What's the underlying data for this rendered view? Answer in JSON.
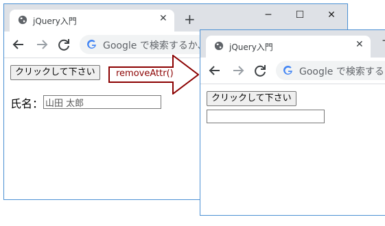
{
  "before": {
    "tab_title": "jQuery入門",
    "omnibox_text": "Google で検索するか、UI",
    "button_label": "クリックして下さい",
    "field_label": "氏名：",
    "field_value": "山田 太郎"
  },
  "after": {
    "tab_title": "jQuery入門",
    "omnibox_text": "Google で検索するか、",
    "button_label": "クリックして下さい",
    "field_value": ""
  },
  "arrow_label": "removeAttr()",
  "icons": {
    "tab_favicon": "globe-icon",
    "tab_close": "close-icon",
    "new_tab": "plus-icon",
    "back": "arrow-left-icon",
    "forward": "arrow-right-icon",
    "reload": "reload-icon",
    "search_provider": "google-g-icon",
    "minimize": "minimize-icon",
    "maximize": "maximize-icon",
    "close_window": "close-icon"
  },
  "colors": {
    "frame_border": "#4a8fd3",
    "tabstrip": "#dee1e6",
    "arrow": "#8b0000"
  }
}
